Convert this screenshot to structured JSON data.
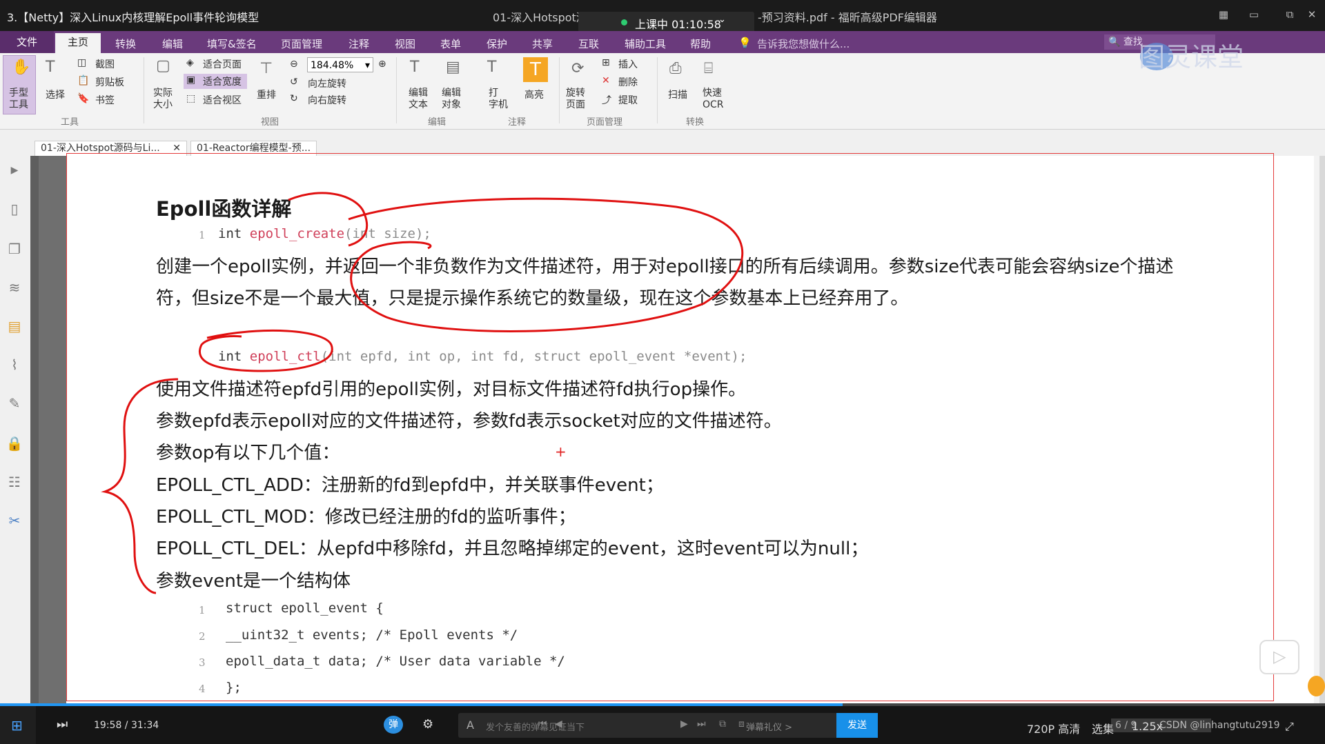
{
  "window": {
    "title": "3.【Netty】深入Linux内核理解Epoll事件轮询模型",
    "center_title": "01-深入Hotspot源码",
    "live_badge": "上课中 01:10:58",
    "right_title": "-预习资料.pdf - 福昕高级PDF编辑器"
  },
  "ribbon": {
    "file_tab": "文件",
    "tabs": [
      "主页",
      "转换",
      "编辑",
      "填写&签名",
      "页面管理",
      "注释",
      "视图",
      "表单",
      "保护",
      "共享",
      "互联",
      "辅助工具",
      "帮助"
    ],
    "tell_me": "告诉我您想做什么...",
    "search_label": "查找"
  },
  "toolbar": {
    "hand": "手型\n工具",
    "select": "选择",
    "screenshot": "截图",
    "clipboard": "剪贴板",
    "bookmark": "书签",
    "group_tools": "工具",
    "actual_size": "实际\n大小",
    "fit_page": "适合页面",
    "fit_width": "适合宽度",
    "fit_view": "适合视区",
    "reflow": "重排",
    "zoom_value": "184.48%",
    "rotate_left": "向左旋转",
    "rotate_right": "向右旋转",
    "group_view": "视图",
    "edit_text": "编辑\n文本",
    "edit_object": "编辑\n对象",
    "typewriter": "打\n字机",
    "highlight": "高亮",
    "group_edit": "编辑",
    "group_comment": "注释",
    "rotate_page": "旋转\n页面",
    "insert": "插入",
    "delete": "删除",
    "extract": "提取",
    "group_pages": "页面管理",
    "scan": "扫描",
    "quick_ocr": "快速\nOCR",
    "group_convert": "转换"
  },
  "doc_tabs": [
    "01-深入Hotspot源码与Li...",
    "01-Reactor编程模型-预..."
  ],
  "document": {
    "heading": "Epoll函数详解",
    "code1": {
      "ln": "1",
      "kw": "int ",
      "fn": "epoll_create",
      "rest": "(int size);"
    },
    "para1a": "创建一个epoll实例，并返回一个非负数作为文件描述符，用于对epoll接口的所有后续调用。参数size代表可能会容纳size个描述",
    "para1b": "符，但size不是一个最大值，只是提示操作系统它的数量级，现在这个参数基本上已经弃用了。",
    "code2": {
      "kw": "int ",
      "fn": "epoll_ctl",
      "rest": "(int epfd, int op, int fd, struct epoll_event *event);"
    },
    "lines": [
      "使用文件描述符epfd引用的epoll实例，对目标文件描述符fd执行op操作。",
      "参数epfd表示epoll对应的文件描述符，参数fd表示socket对应的文件描述符。",
      "参数op有以下几个值：",
      "EPOLL_CTL_ADD：注册新的fd到epfd中，并关联事件event；",
      "EPOLL_CTL_MOD：修改已经注册的fd的监听事件；",
      "EPOLL_CTL_DEL：从epfd中移除fd，并且忽略掉绑定的event，这时event可以为null；",
      "参数event是一个结构体"
    ],
    "struct_lines": [
      {
        "ln": "1",
        "code": "struct epoll_event {"
      },
      {
        "ln": "2",
        "code": "__uint32_t events; /* Epoll events */"
      },
      {
        "ln": "3",
        "code": "epoll_data_t data; /* User data variable */"
      },
      {
        "ln": "4",
        "code": "};"
      }
    ]
  },
  "player": {
    "time": "19:58 / 31:34",
    "progress": 0.636,
    "danmaku_placeholder": "发个友善的弹幕见证当下",
    "page_indicator": "6 / 9",
    "danmaku_etiquette": "弹幕礼仪 >",
    "send": "发送",
    "quality": "720P 高清",
    "episodes": "选集",
    "speed": "1.25x",
    "watermark": "CSDN @linhangtutu2919"
  },
  "logo_text": "图灵课堂"
}
